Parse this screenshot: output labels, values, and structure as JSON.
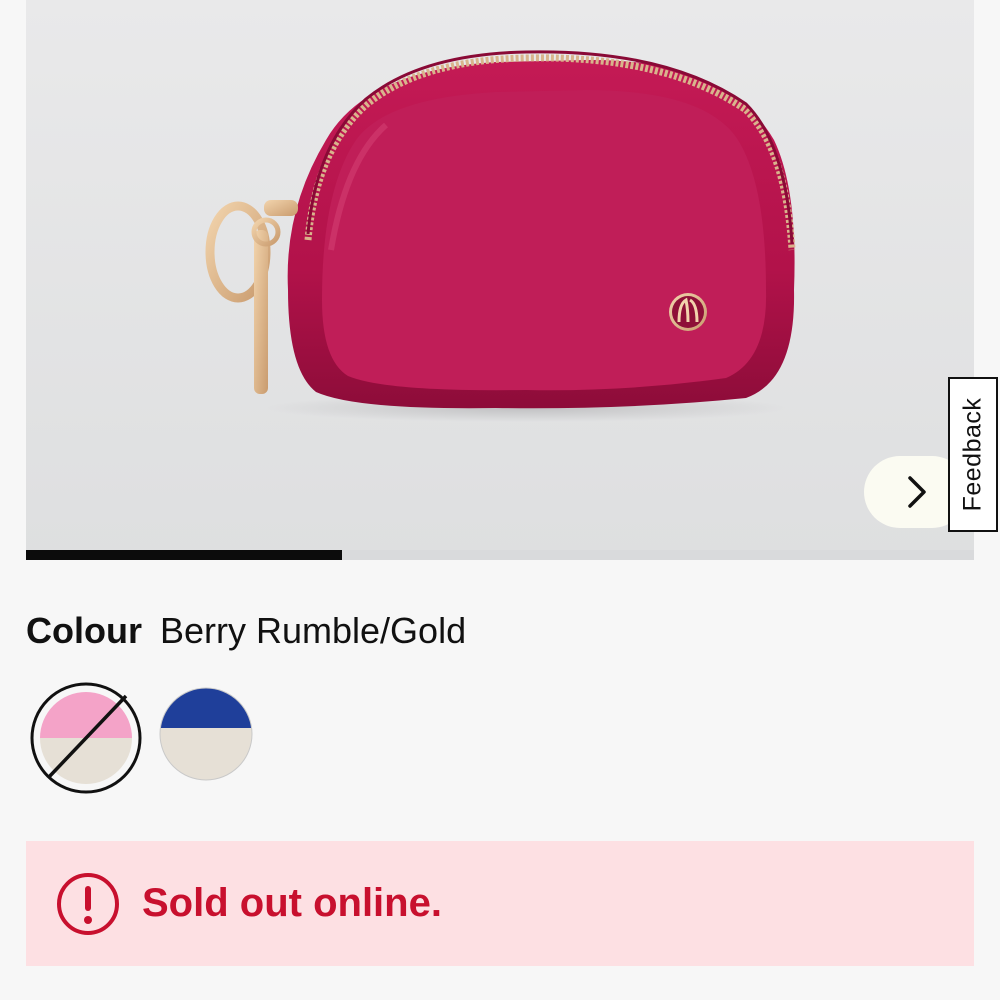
{
  "gallery": {
    "product_image": "berry-rumble-pouch-image",
    "progress_fraction": 0.333,
    "next_icon": "chevron-right-icon"
  },
  "feedback": {
    "label": "Feedback"
  },
  "colour": {
    "label": "Colour",
    "value": "Berry Rumble/Gold",
    "swatches": [
      {
        "name": "Berry Rumble/Gold",
        "top": "#f4a3c8",
        "bottom": "#e6e0d6",
        "selected": true,
        "sold_out": true
      },
      {
        "name": "navy",
        "top": "#1f3f9a",
        "bottom": "#e6e0d6",
        "selected": false,
        "sold_out": false
      }
    ]
  },
  "alert": {
    "icon": "alert-circle-icon",
    "message": "Sold out online.",
    "color": "#c8102e",
    "background": "#fde0e3"
  }
}
